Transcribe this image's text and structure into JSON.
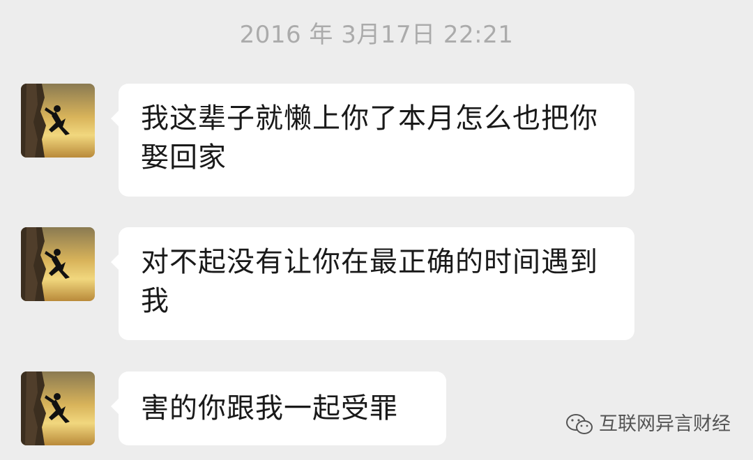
{
  "chat": {
    "timestamp": "2016 年 3月17日  22:21",
    "messages": [
      {
        "sender": "other",
        "avatar": "climber-sunset-avatar",
        "text": "我这辈子就懒上你了本月怎么也把你娶回家"
      },
      {
        "sender": "other",
        "avatar": "climber-sunset-avatar",
        "text": "对不起没有让你在最正确的时间遇到我"
      },
      {
        "sender": "other",
        "avatar": "climber-sunset-avatar",
        "text": "害的你跟我一起受罪"
      }
    ]
  },
  "watermark": {
    "icon": "wechat-logo-icon",
    "text": "互联网异言财经"
  },
  "colors": {
    "background": "#ededed",
    "bubble": "#ffffff",
    "text": "#191919",
    "timestamp": "#ababab"
  }
}
